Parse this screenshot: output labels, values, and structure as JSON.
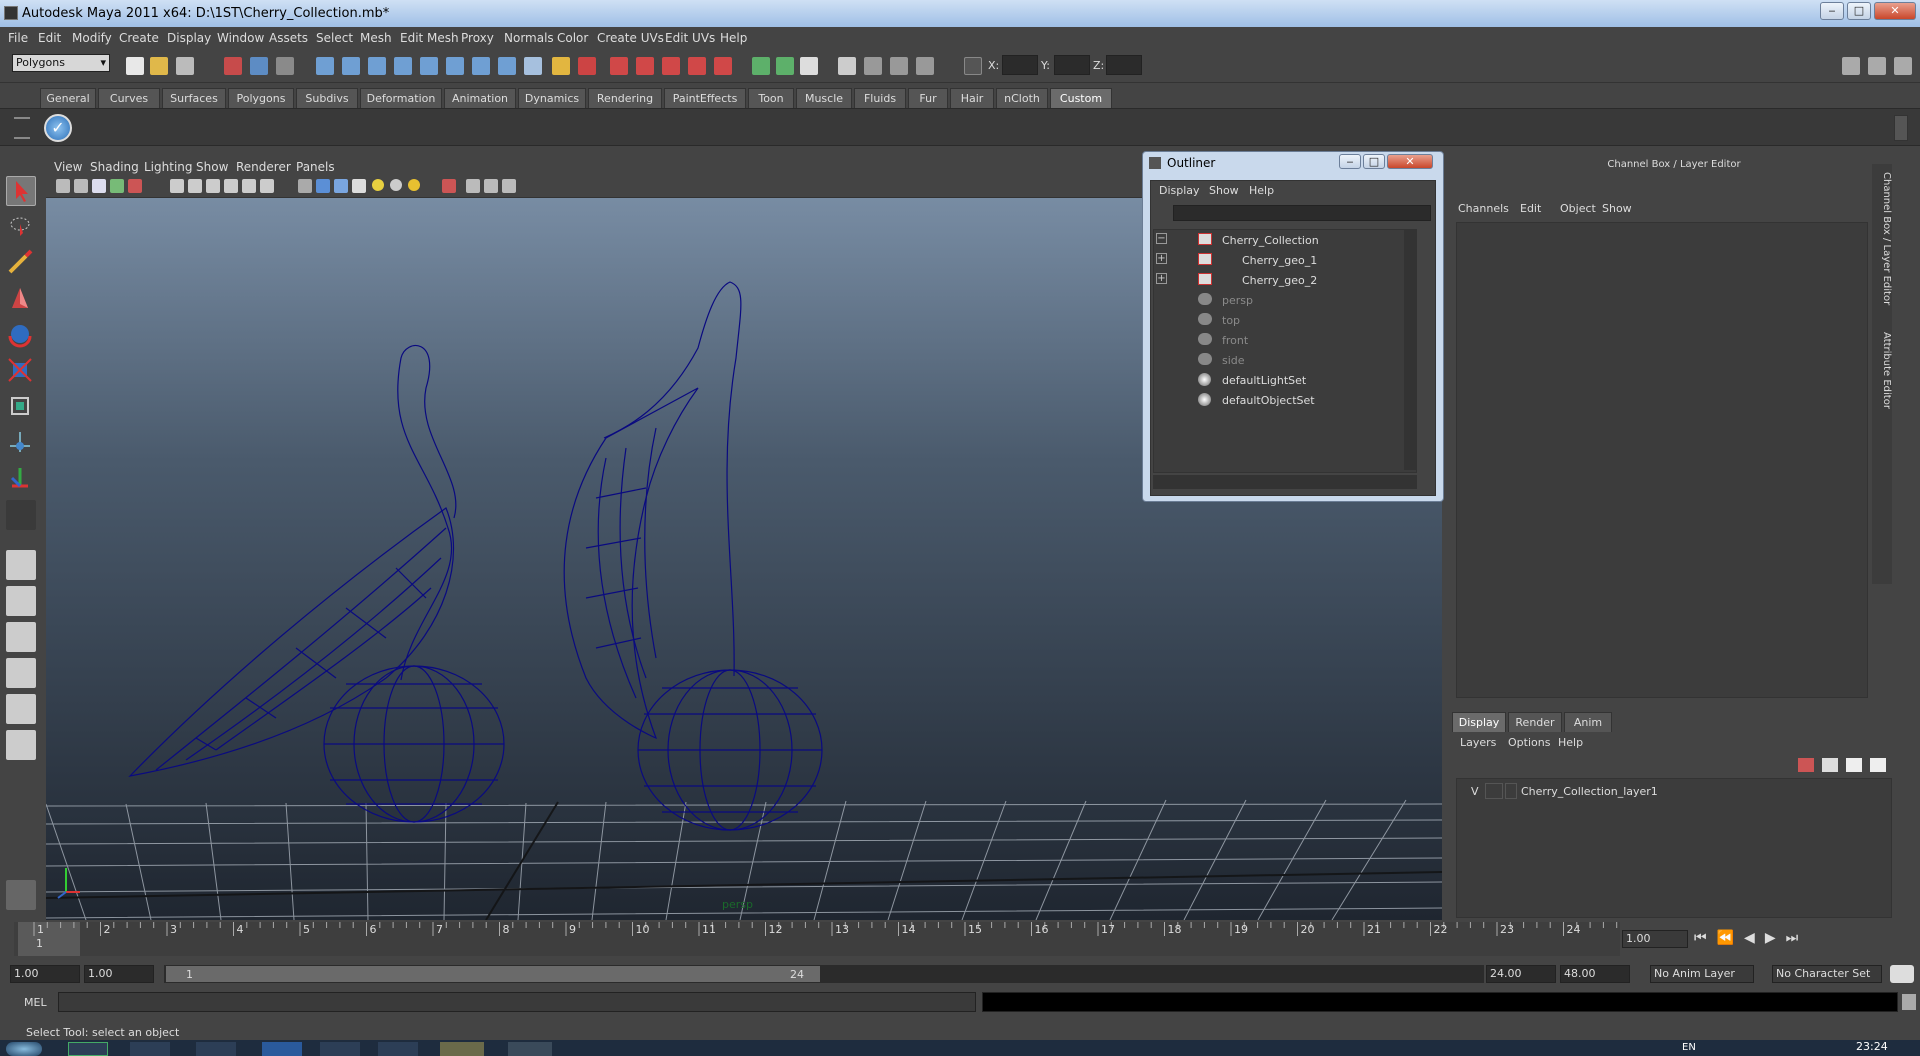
{
  "window": {
    "title": "Autodesk Maya 2011 x64: D:\\1ST\\Cherry_Collection.mb*",
    "min": "‒",
    "max": "□",
    "close": "✕"
  },
  "menubar": [
    "File",
    "Edit",
    "Modify",
    "Create",
    "Display",
    "Window",
    "Assets",
    "Select",
    "Mesh",
    "Edit Mesh",
    "Proxy",
    "Normals",
    "Color",
    "Create UVs",
    "Edit UVs",
    "Help"
  ],
  "toolbar": {
    "mode": "Polygons",
    "x_label": "X:",
    "y_label": "Y:",
    "z_label": "Z:"
  },
  "shelf_tabs": [
    "General",
    "Curves",
    "Surfaces",
    "Polygons",
    "Subdivs",
    "Deformation",
    "Animation",
    "Dynamics",
    "Rendering",
    "PaintEffects",
    "Toon",
    "Muscle",
    "Fluids",
    "Fur",
    "Hair",
    "nCloth",
    "Custom"
  ],
  "active_shelf": "Custom",
  "viewport": {
    "menu": [
      "View",
      "Shading",
      "Lighting",
      "Show",
      "Renderer",
      "Panels"
    ],
    "camera_label": "persp"
  },
  "outliner": {
    "title": "Outliner",
    "menu": [
      "Display",
      "Show",
      "Help"
    ],
    "items": [
      {
        "label": "Cherry_Collection",
        "expander": "−"
      },
      {
        "label": "Cherry_geo_1",
        "expander": "+"
      },
      {
        "label": "Cherry_geo_2",
        "expander": "+"
      },
      {
        "label": "persp",
        "expander": ""
      },
      {
        "label": "top",
        "expander": ""
      },
      {
        "label": "front",
        "expander": ""
      },
      {
        "label": "side",
        "expander": ""
      },
      {
        "label": "defaultLightSet",
        "expander": ""
      },
      {
        "label": "defaultObjectSet",
        "expander": ""
      }
    ]
  },
  "channel_box": {
    "title": "Channel Box / Layer Editor",
    "menu": [
      "Channels",
      "Edit",
      "Object",
      "Show"
    ],
    "side_tabs": [
      "Channel Box / Layer Editor",
      "Attribute Editor"
    ]
  },
  "layer_editor": {
    "tabs": [
      "Display",
      "Render",
      "Anim"
    ],
    "menu": [
      "Layers",
      "Options",
      "Help"
    ],
    "layers": [
      {
        "visible": "V",
        "name": "Cherry_Collection_layer1"
      }
    ]
  },
  "time_slider": {
    "ticks": [
      "1",
      "2",
      "3",
      "4",
      "5",
      "6",
      "7",
      "8",
      "9",
      "10",
      "11",
      "12",
      "13",
      "14",
      "15",
      "16",
      "17",
      "18",
      "19",
      "20",
      "21",
      "22",
      "23",
      "24"
    ],
    "current_frame_label": "1",
    "current_time": "1.00"
  },
  "range_slider": {
    "start": "1.00",
    "playback_start": "1.00",
    "range_min": "1",
    "range_max": "24",
    "playback_end": "24.00",
    "end": "48.00",
    "anim_layer": "No Anim Layer",
    "character_set": "No Character Set"
  },
  "command_line": {
    "label": "MEL",
    "value": ""
  },
  "help_line": "Select Tool: select an object",
  "taskbar": {
    "lang": "EN",
    "clock": "23:24"
  }
}
